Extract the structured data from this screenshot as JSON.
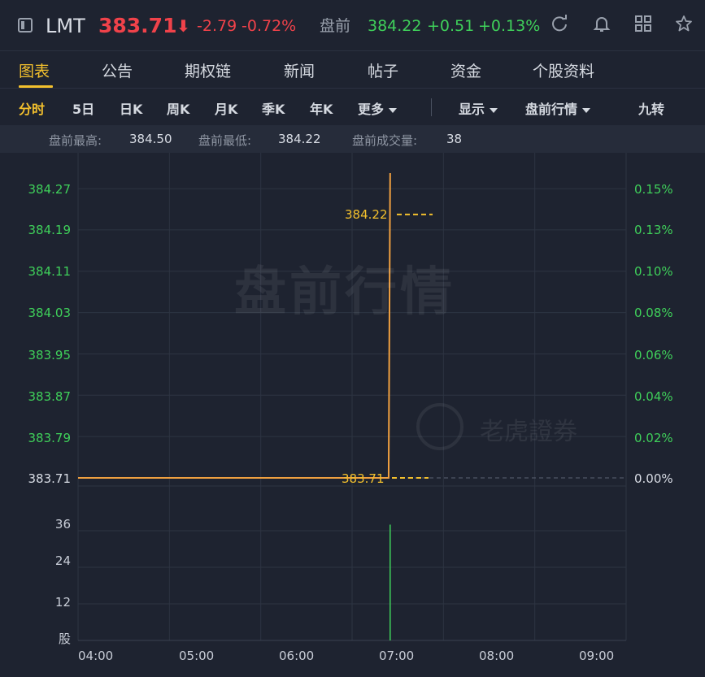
{
  "header": {
    "symbol": "LMT",
    "price": "383.71",
    "arrow": "⬇",
    "change": "-2.79",
    "change_pct": "-0.72%",
    "premarket_label": "盘前",
    "premarket_price": "384.22",
    "premarket_change": "+0.51",
    "premarket_change_pct": "+0.13%",
    "icons": [
      "panel-icon",
      "refresh-icon",
      "bell-icon",
      "grid-icon",
      "star-icon"
    ]
  },
  "tabs": [
    "图表",
    "公告",
    "期权链",
    "新闻",
    "帖子",
    "资金",
    "个股资料"
  ],
  "active_tab": "图表",
  "periods": {
    "items": [
      "分时",
      "5日",
      "日K",
      "周K",
      "月K",
      "季K",
      "年K"
    ],
    "more": "更多",
    "display": "显示",
    "premarket": "盘前行情",
    "nine": "九转"
  },
  "stats": {
    "high_label": "盘前最高:",
    "high_value": "384.50",
    "low_label": "盘前最低:",
    "low_value": "384.22",
    "vol_label": "盘前成交量:",
    "vol_value": "38"
  },
  "chart": {
    "watermark": "盘前行情",
    "logo_text": "老虎證券",
    "price_ticks": [
      "384.27",
      "384.19",
      "384.11",
      "384.03",
      "383.95",
      "383.87",
      "383.79",
      "383.71"
    ],
    "pct_ticks": [
      "0.15%",
      "0.13%",
      "0.10%",
      "0.08%",
      "0.06%",
      "0.04%",
      "0.02%",
      "0.00%"
    ],
    "volume_ticks": [
      "36",
      "24",
      "12",
      "股"
    ],
    "time_ticks": [
      "04:00",
      "05:00",
      "06:00",
      "07:00",
      "08:00",
      "09:00"
    ],
    "last_price_tag": "384.22",
    "base_price_tag": "383.71"
  },
  "chart_data": {
    "type": "line",
    "x": [
      "04:00",
      "07:24",
      "07:25"
    ],
    "y": [
      383.71,
      383.71,
      384.3
    ],
    "ylim": [
      383.71,
      384.3
    ],
    "volume": {
      "x": [
        "07:25"
      ],
      "values": [
        38
      ]
    },
    "colors": {
      "line": "#f0a040",
      "up": "#3fd05a",
      "down": "#f0424a",
      "accent": "#f3c02d"
    }
  }
}
